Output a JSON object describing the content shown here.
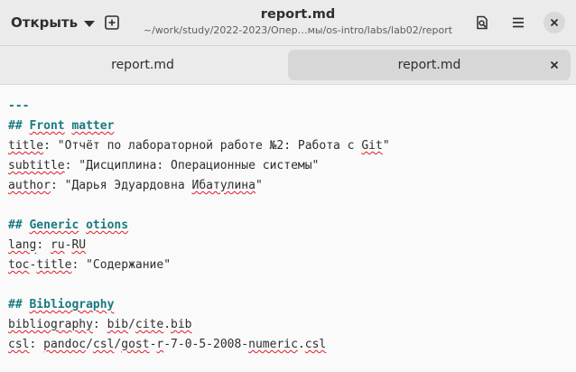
{
  "header": {
    "open_label": "Открыть",
    "title": "report.md",
    "subtitle": "~/work/study/2022-2023/Опер…мы/os-intro/labs/lab02/report"
  },
  "tabs": [
    {
      "label": "report.md",
      "active": false
    },
    {
      "label": "report.md",
      "active": true
    }
  ],
  "editor": {
    "lines": [
      {
        "parts": [
          {
            "t": "---",
            "c": "c-hr"
          }
        ]
      },
      {
        "parts": [
          {
            "t": "## ",
            "c": "c-head"
          },
          {
            "t": "Front",
            "c": "c-head spell"
          },
          {
            "t": " ",
            "c": "c-head"
          },
          {
            "t": "matter",
            "c": "c-head spell"
          }
        ]
      },
      {
        "parts": [
          {
            "t": "title",
            "c": "c-key spell"
          },
          {
            "t": ": \"Отчёт по лабораторной работе №2: Работа с ",
            "c": "c-str"
          },
          {
            "t": "Git",
            "c": "c-str spell"
          },
          {
            "t": "\"",
            "c": "c-str"
          }
        ]
      },
      {
        "parts": [
          {
            "t": "subtitle",
            "c": "c-key spell"
          },
          {
            "t": ": \"Дисциплина: Операционные системы\"",
            "c": "c-str"
          }
        ]
      },
      {
        "parts": [
          {
            "t": "author",
            "c": "c-key spell"
          },
          {
            "t": ": \"Дарья Эдуардовна ",
            "c": "c-str"
          },
          {
            "t": "Ибатулина",
            "c": "c-str spell"
          },
          {
            "t": "\"",
            "c": "c-str"
          }
        ]
      },
      {
        "parts": [
          {
            "t": "",
            "c": ""
          }
        ]
      },
      {
        "parts": [
          {
            "t": "## ",
            "c": "c-head"
          },
          {
            "t": "Generic",
            "c": "c-head spell"
          },
          {
            "t": " ",
            "c": "c-head"
          },
          {
            "t": "otions",
            "c": "c-head spell"
          }
        ]
      },
      {
        "parts": [
          {
            "t": "lang",
            "c": "c-key spell"
          },
          {
            "t": ": ",
            "c": "c-str"
          },
          {
            "t": "ru",
            "c": "c-str spell"
          },
          {
            "t": "-",
            "c": "c-str"
          },
          {
            "t": "RU",
            "c": "c-str spell"
          }
        ]
      },
      {
        "parts": [
          {
            "t": "toc",
            "c": "c-key spell"
          },
          {
            "t": "-",
            "c": "c-key"
          },
          {
            "t": "title",
            "c": "c-key spell"
          },
          {
            "t": ": \"Содержание\"",
            "c": "c-str"
          }
        ]
      },
      {
        "parts": [
          {
            "t": "",
            "c": ""
          }
        ]
      },
      {
        "parts": [
          {
            "t": "## ",
            "c": "c-head"
          },
          {
            "t": "Bibliography",
            "c": "c-head spell"
          }
        ]
      },
      {
        "parts": [
          {
            "t": "bibliography",
            "c": "c-key spell"
          },
          {
            "t": ": ",
            "c": "c-str"
          },
          {
            "t": "bib",
            "c": "c-str spell"
          },
          {
            "t": "/",
            "c": "c-str"
          },
          {
            "t": "cite",
            "c": "c-str spell"
          },
          {
            "t": ".",
            "c": "c-str"
          },
          {
            "t": "bib",
            "c": "c-str spell"
          }
        ]
      },
      {
        "parts": [
          {
            "t": "csl",
            "c": "c-key spell"
          },
          {
            "t": ": ",
            "c": "c-str"
          },
          {
            "t": "pandoc",
            "c": "c-str spell"
          },
          {
            "t": "/",
            "c": "c-str"
          },
          {
            "t": "csl",
            "c": "c-str spell"
          },
          {
            "t": "/",
            "c": "c-str"
          },
          {
            "t": "gost",
            "c": "c-str spell"
          },
          {
            "t": "-",
            "c": "c-str"
          },
          {
            "t": "r",
            "c": "c-str spell"
          },
          {
            "t": "-7-0-5-2008-",
            "c": "c-str"
          },
          {
            "t": "numeric",
            "c": "c-str spell"
          },
          {
            "t": ".",
            "c": "c-str"
          },
          {
            "t": "csl",
            "c": "c-str spell"
          }
        ]
      }
    ]
  },
  "icons": {
    "open_caret": "chevron-down-icon",
    "new_tab": "new-tab-icon",
    "search": "document-search-icon",
    "menu": "hamburger-menu-icon",
    "close": "close-icon"
  },
  "colors": {
    "accent": "#1a7a80",
    "spellcheck": "#e01b24"
  }
}
